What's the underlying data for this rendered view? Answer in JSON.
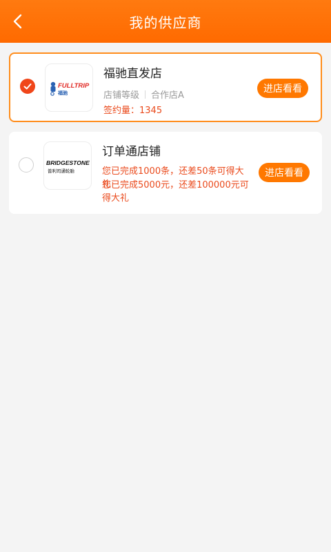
{
  "header": {
    "title": "我的供应商",
    "back_icon": "chevron-left-icon"
  },
  "suppliers": [
    {
      "name": "福驰直发店",
      "selected": true,
      "logo_text": "FULLTRIP",
      "logo_sub": "福驰",
      "level_label": "店铺等级",
      "level_value": "合作店A",
      "signed_text": "签约量：1345",
      "button_label": "进店看看"
    },
    {
      "name": "订单通店铺",
      "selected": false,
      "logo_text": "BRIDGESTONE",
      "logo_sub": "普利司通轮胎",
      "note_line1": "您已完成1000条，还差50条可得大礼",
      "note_line2": "您已完成5000元，还差100000元可得大礼",
      "button_label": "进店看看"
    }
  ],
  "colors": {
    "header": "#ff7200",
    "accent": "#ea4a1c",
    "button": "#ff7800",
    "selected_border": "#ff8c1a"
  }
}
